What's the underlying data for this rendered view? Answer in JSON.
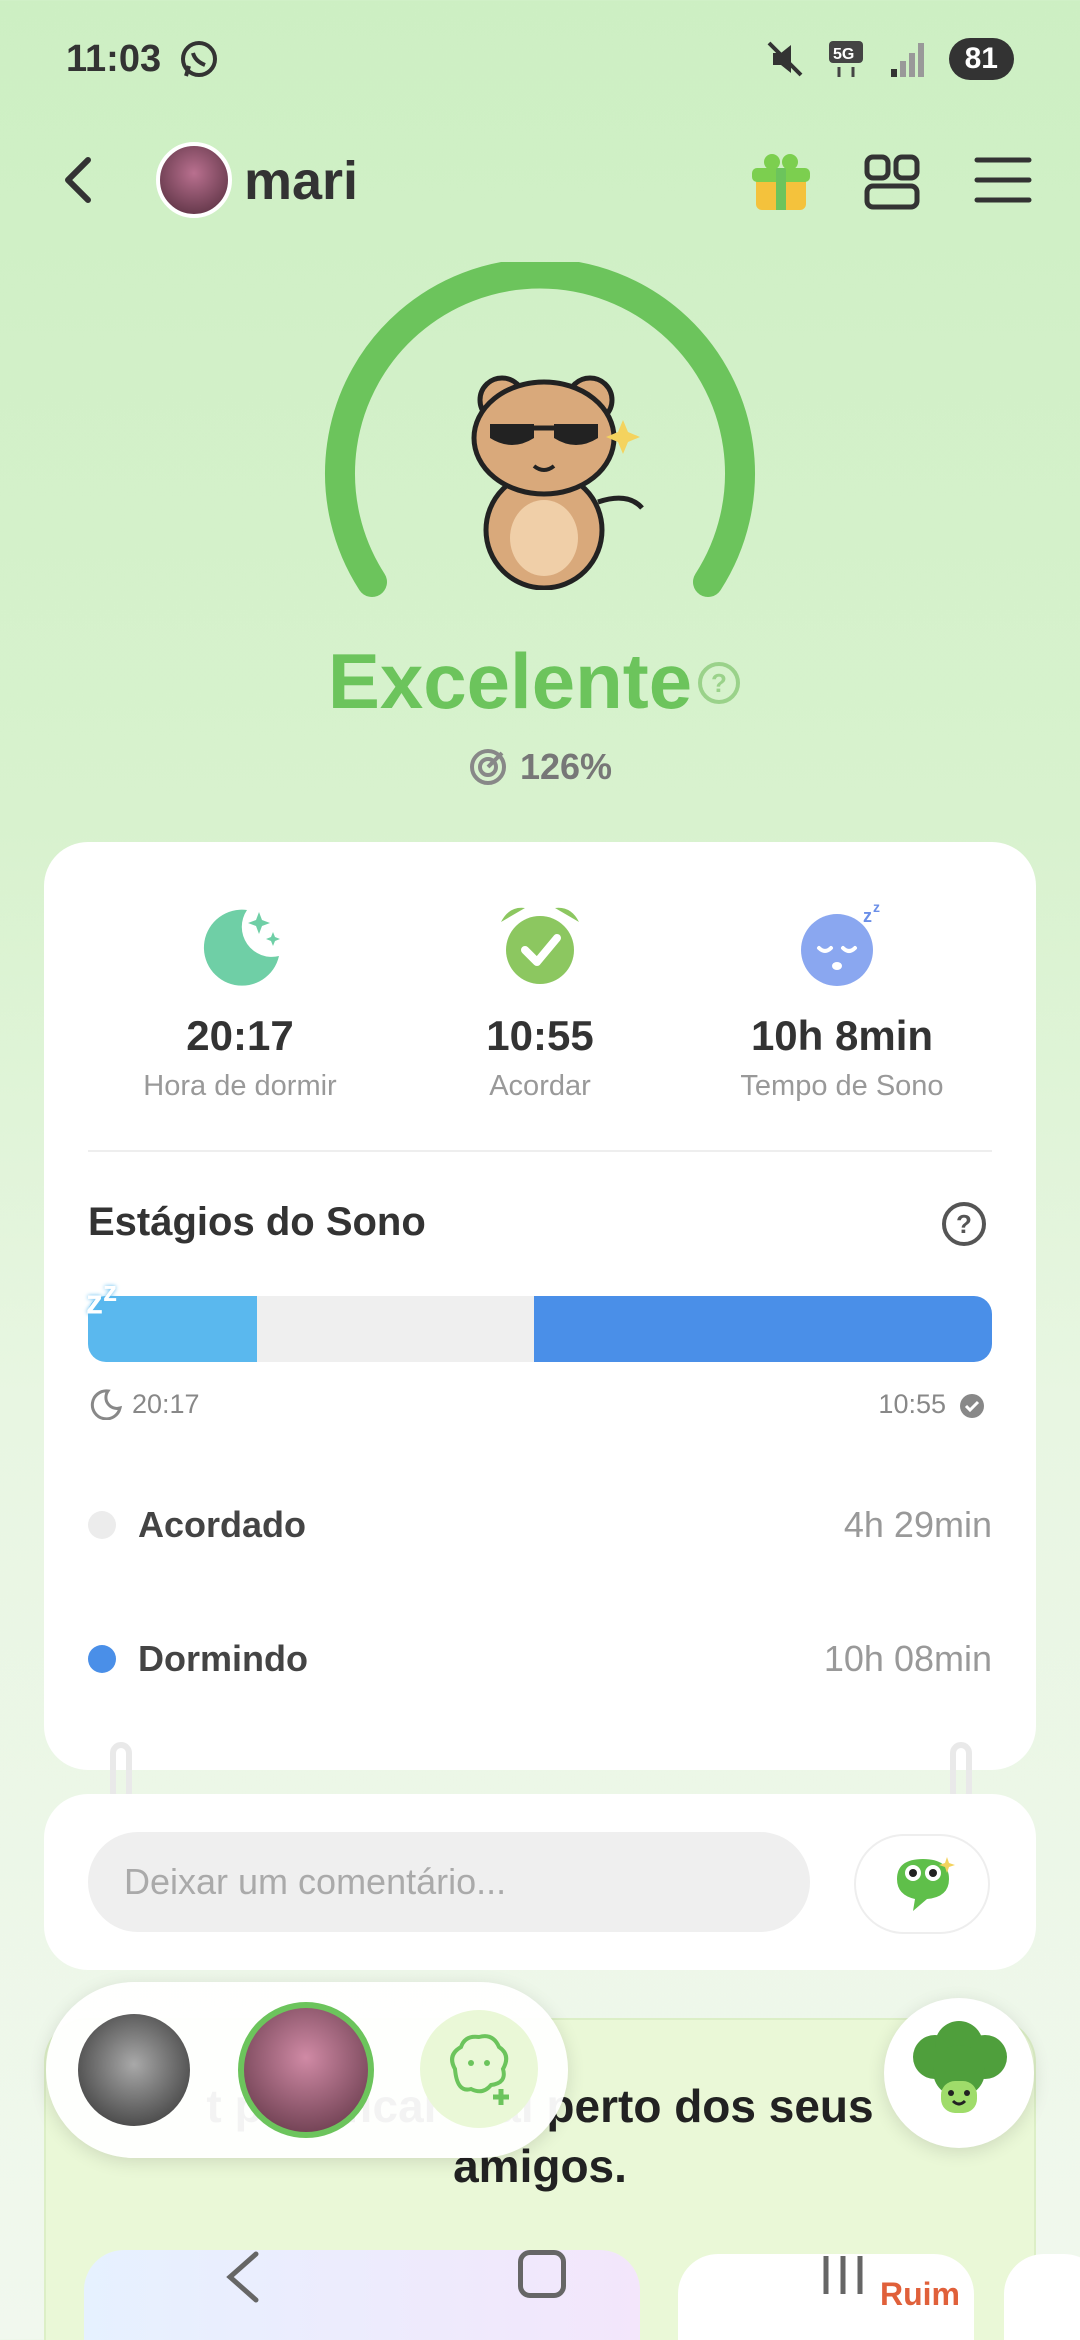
{
  "status_bar": {
    "time": "11:03",
    "battery": "81",
    "network": "5G"
  },
  "header": {
    "user_name": "mari"
  },
  "score": {
    "title": "Excelente",
    "percent": "126%",
    "gauge_color": "#6cc45c"
  },
  "summary": {
    "bedtime": {
      "value": "20:17",
      "label": "Hora de dormir"
    },
    "wake": {
      "value": "10:55",
      "label": "Acordar"
    },
    "duration": {
      "value": "10h 8min",
      "label": "Tempo de Sono"
    }
  },
  "stages": {
    "title": "Estágios do Sono",
    "start_time": "20:17",
    "end_time": "10:55",
    "segments": [
      {
        "state": "sleep",
        "fraction": 0.187,
        "color": "#5ab8ee"
      },
      {
        "state": "awake",
        "fraction": 0.306,
        "color": "#efefef"
      },
      {
        "state": "sleep",
        "fraction": 0.507,
        "color": "#4a8fe8"
      }
    ],
    "legend": [
      {
        "label": "Acordado",
        "value": "4h 29min",
        "color": "#ececec"
      },
      {
        "label": "Dormindo",
        "value": "10h 08min",
        "color": "#4a8fe8"
      }
    ]
  },
  "comment": {
    "placeholder": "Deixar um comentário..."
  },
  "promo": {
    "text": "t para ficar mai perto dos seus amigos.",
    "badge": "Ruim"
  }
}
